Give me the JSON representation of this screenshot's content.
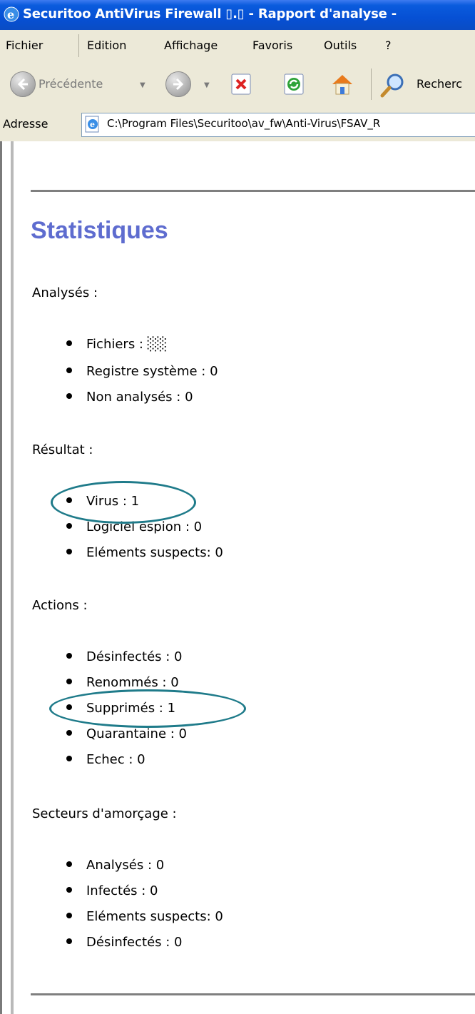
{
  "window": {
    "title": "Securitoo AntiVirus Firewall ▯.▯ - Rapport d'analyse -"
  },
  "menu": [
    "Fichier",
    "Edition",
    "Affichage",
    "Favoris",
    "Outils",
    "?"
  ],
  "toolbar": {
    "back_label": "Précédente",
    "search_label": "Recherc"
  },
  "address": {
    "label": "Adresse",
    "url": "C:\\Program Files\\Securitoo\\av_fw\\Anti-Virus\\FSAV_R"
  },
  "report": {
    "heading": "Statistiques",
    "sections": [
      {
        "label": "Analysés :",
        "items": [
          "Fichiers : ░░",
          "Registre système : 0",
          "Non analysés : 0"
        ]
      },
      {
        "label": "Résultat :",
        "items": [
          "Virus : 1",
          "Logiciel espion : 0",
          "Eléments suspects: 0"
        ]
      },
      {
        "label": "Actions :",
        "items": [
          "Désinfectés : 0",
          "Renommés : 0",
          "Supprimés : 1",
          "Quarantaine : 0",
          "Echec : 0"
        ]
      },
      {
        "label": "Secteurs d'amorçage :",
        "items": [
          "Analysés : 0",
          "Infectés : 0",
          "Eléments suspects: 0",
          "Désinfectés : 0"
        ]
      }
    ]
  },
  "colors": {
    "heading": "#5e6ccf",
    "highlight_ellipse": "#1f7b8a",
    "titlebar": "#0a5bdd"
  }
}
